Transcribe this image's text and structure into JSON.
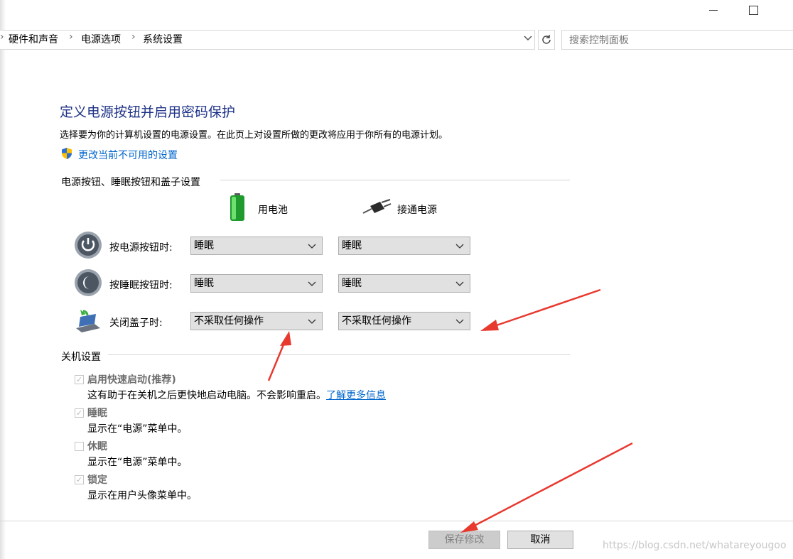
{
  "window": {
    "minimize_icon": "minimize-icon",
    "maximize_icon": "maximize-icon"
  },
  "breadcrumb": {
    "items": [
      "硬件和声音",
      "电源选项",
      "系统设置"
    ],
    "separator": "›"
  },
  "search": {
    "placeholder": "搜索控制面板"
  },
  "page": {
    "title": "定义电源按钮并启用密码保护",
    "description": "选择要为你的计算机设置的电源设置。在此页上对设置所做的更改将应用于你所有的电源计划。",
    "change_link": "更改当前不可用的设置"
  },
  "buttons_section": {
    "heading": "电源按钮、睡眠按钮和盖子设置",
    "col_battery": "用电池",
    "col_plugged": "接通电源",
    "rows": [
      {
        "label": "按电源按钮时:",
        "battery": "睡眠",
        "plugged": "睡眠",
        "icon": "power-button-icon"
      },
      {
        "label": "按睡眠按钮时:",
        "battery": "睡眠",
        "plugged": "睡眠",
        "icon": "sleep-button-icon"
      },
      {
        "label": "关闭盖子时:",
        "battery": "不采取任何操作",
        "plugged": "不采取任何操作",
        "icon": "laptop-lid-icon"
      }
    ]
  },
  "shutdown_section": {
    "heading": "关机设置",
    "items": [
      {
        "label": "启用快速启动(推荐)",
        "desc": "这有助于在关机之后更快地启动电脑。不会影响重启。",
        "link": "了解更多信息",
        "checked": true
      },
      {
        "label": "睡眠",
        "desc": "显示在“电源”菜单中。",
        "checked": true
      },
      {
        "label": "休眠",
        "desc": "显示在“电源”菜单中。",
        "checked": false
      },
      {
        "label": "锁定",
        "desc": "显示在用户头像菜单中。",
        "checked": true
      }
    ]
  },
  "footer": {
    "save": "保存修改",
    "cancel": "取消"
  },
  "watermark": "https://blog.csdn.net/whatareyougoo",
  "colors": {
    "title": "#1e3287",
    "link": "#0066cc",
    "arrow": "#e8392f"
  }
}
